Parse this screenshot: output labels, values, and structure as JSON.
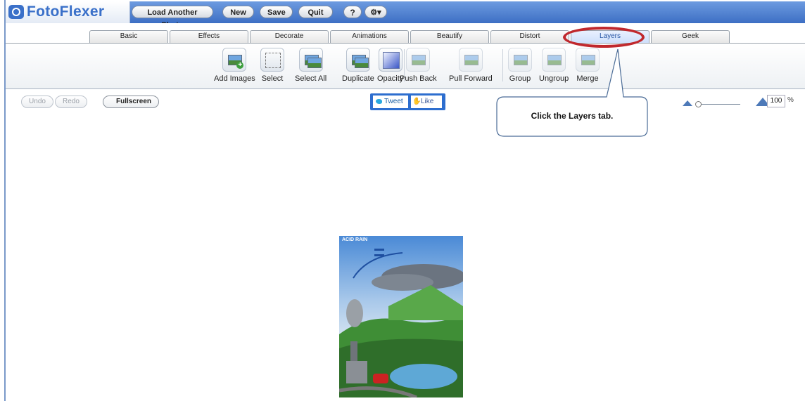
{
  "app": {
    "logo_text": "FotoFlexer"
  },
  "topbar": {
    "buttons": [
      "Load Another Photo",
      "New",
      "Save",
      "Quit"
    ],
    "help_label": "?",
    "settings_label": "⚙▾"
  },
  "tabs": [
    {
      "label": "Basic"
    },
    {
      "label": "Effects"
    },
    {
      "label": "Decorate"
    },
    {
      "label": "Animations"
    },
    {
      "label": "Beautify"
    },
    {
      "label": "Distort"
    },
    {
      "label": "Layers"
    },
    {
      "label": "Geek"
    }
  ],
  "active_tab": "Layers",
  "toolbar": {
    "tools": [
      {
        "label": "Add Images"
      },
      {
        "label": "Select"
      },
      {
        "label": "Select All"
      },
      {
        "label": "Duplicate"
      },
      {
        "label": "Opacity"
      },
      {
        "label": "Push Back"
      },
      {
        "label": "Pull Forward"
      },
      {
        "label": "Group"
      },
      {
        "label": "Ungroup"
      },
      {
        "label": "Merge"
      }
    ]
  },
  "edit": {
    "undo": "Undo",
    "redo": "Redo",
    "fullscreen": "Fullscreen"
  },
  "social": {
    "tweet": "Tweet",
    "like": "Like"
  },
  "zoom": {
    "value": "100",
    "unit": "%"
  },
  "callout": {
    "text": "Click the Layers tab."
  },
  "photo": {
    "title": "ACID RAIN"
  },
  "colors": {
    "accent": "#3d6fc4",
    "highlight_ring": "#c0282d"
  }
}
